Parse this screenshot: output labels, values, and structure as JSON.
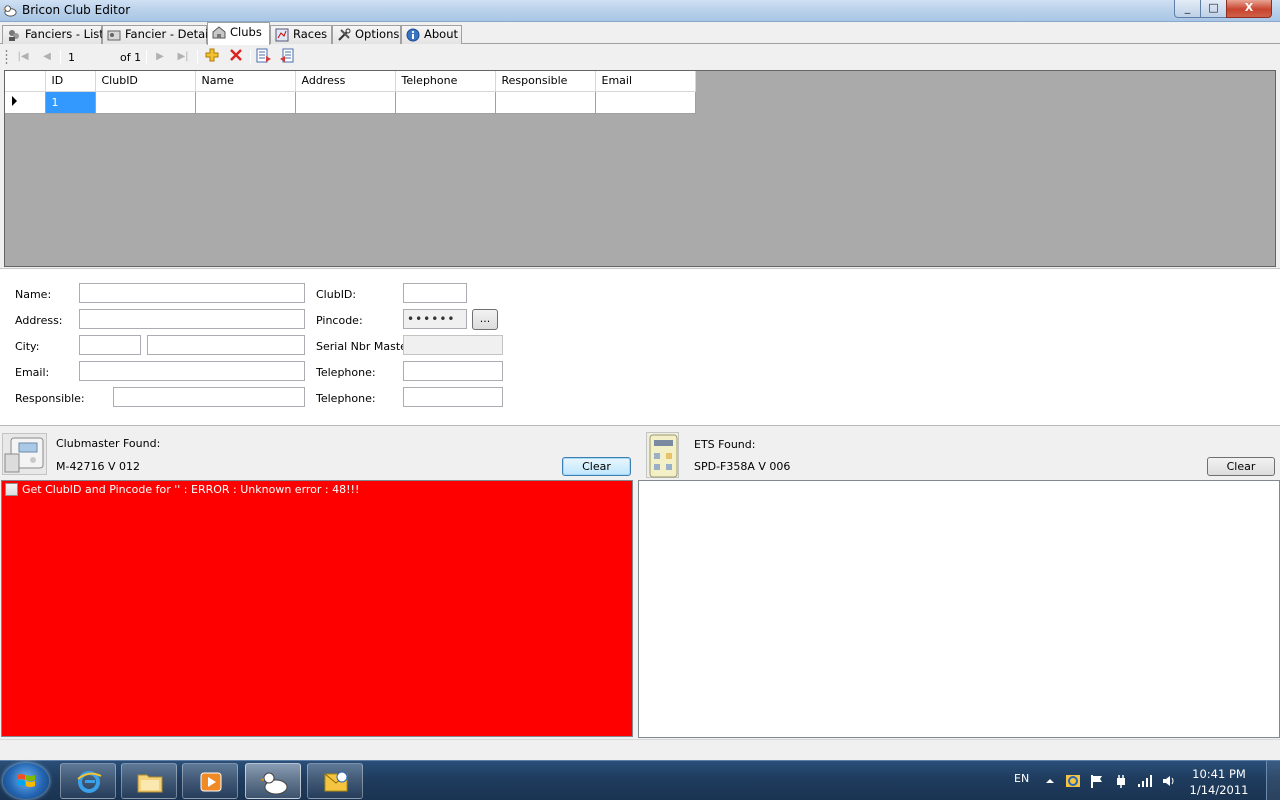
{
  "window": {
    "title": "Bricon Club Editor",
    "minimize_glyph": "_",
    "maximize_glyph": "□",
    "close_glyph": "X"
  },
  "tabs": [
    {
      "label": "Fanciers - List",
      "icon": "fanciers-list-icon"
    },
    {
      "label": "Fancier - Detail",
      "icon": "fancier-detail-icon"
    },
    {
      "label": "Clubs",
      "icon": "clubs-icon",
      "active": true
    },
    {
      "label": "Races",
      "icon": "races-icon"
    },
    {
      "label": "Options",
      "icon": "options-icon"
    },
    {
      "label": "About",
      "icon": "about-icon"
    }
  ],
  "navigator": {
    "position": "1",
    "count_label": "of 1",
    "first_glyph": "|◀",
    "prev_glyph": "◀",
    "next_glyph": "▶",
    "last_glyph": "▶|"
  },
  "grid": {
    "columns": [
      "ID",
      "ClubID",
      "Name",
      "Address",
      "Telephone",
      "Responsible",
      "Email"
    ],
    "rows": [
      [
        "1",
        "",
        "",
        "",
        "",
        "",
        ""
      ]
    ]
  },
  "form": {
    "name_label": "Name:",
    "name_value": "",
    "address_label": "Address:",
    "address_value": "",
    "city_label": "City:",
    "city_zip_value": "",
    "city_value": "",
    "email_label": "Email:",
    "email_value": "",
    "responsible_label": "Responsible:",
    "responsible_value": "",
    "clubid_label": "ClubID:",
    "clubid_value": "",
    "pincode_label": "Pincode:",
    "pincode_value": "••••••",
    "pincode_browse": "...",
    "serial_label": "Serial Nbr Master:",
    "serial_value": "",
    "telephone_label": "Telephone:",
    "telephone_value": "",
    "telephone2_label": "Telephone:",
    "telephone2_value": ""
  },
  "clubmaster": {
    "found_label": "Clubmaster Found:",
    "device": "M-42716 V 012",
    "clear_label": "Clear",
    "log": [
      "Get ClubID and Pincode for '' : ERROR : Unknown error : 48!!!"
    ],
    "log_bg": "#ff0000"
  },
  "ets": {
    "found_label": "ETS Found:",
    "device": "SPD-F358A V 006",
    "clear_label": "Clear",
    "log": []
  },
  "taskbar": {
    "pinned": [
      "start-orb",
      "internet-explorer",
      "windows-explorer",
      "media-player",
      "bricon-app",
      "outlook"
    ],
    "language": "EN",
    "time": "10:41 PM",
    "date": "1/14/2011"
  }
}
